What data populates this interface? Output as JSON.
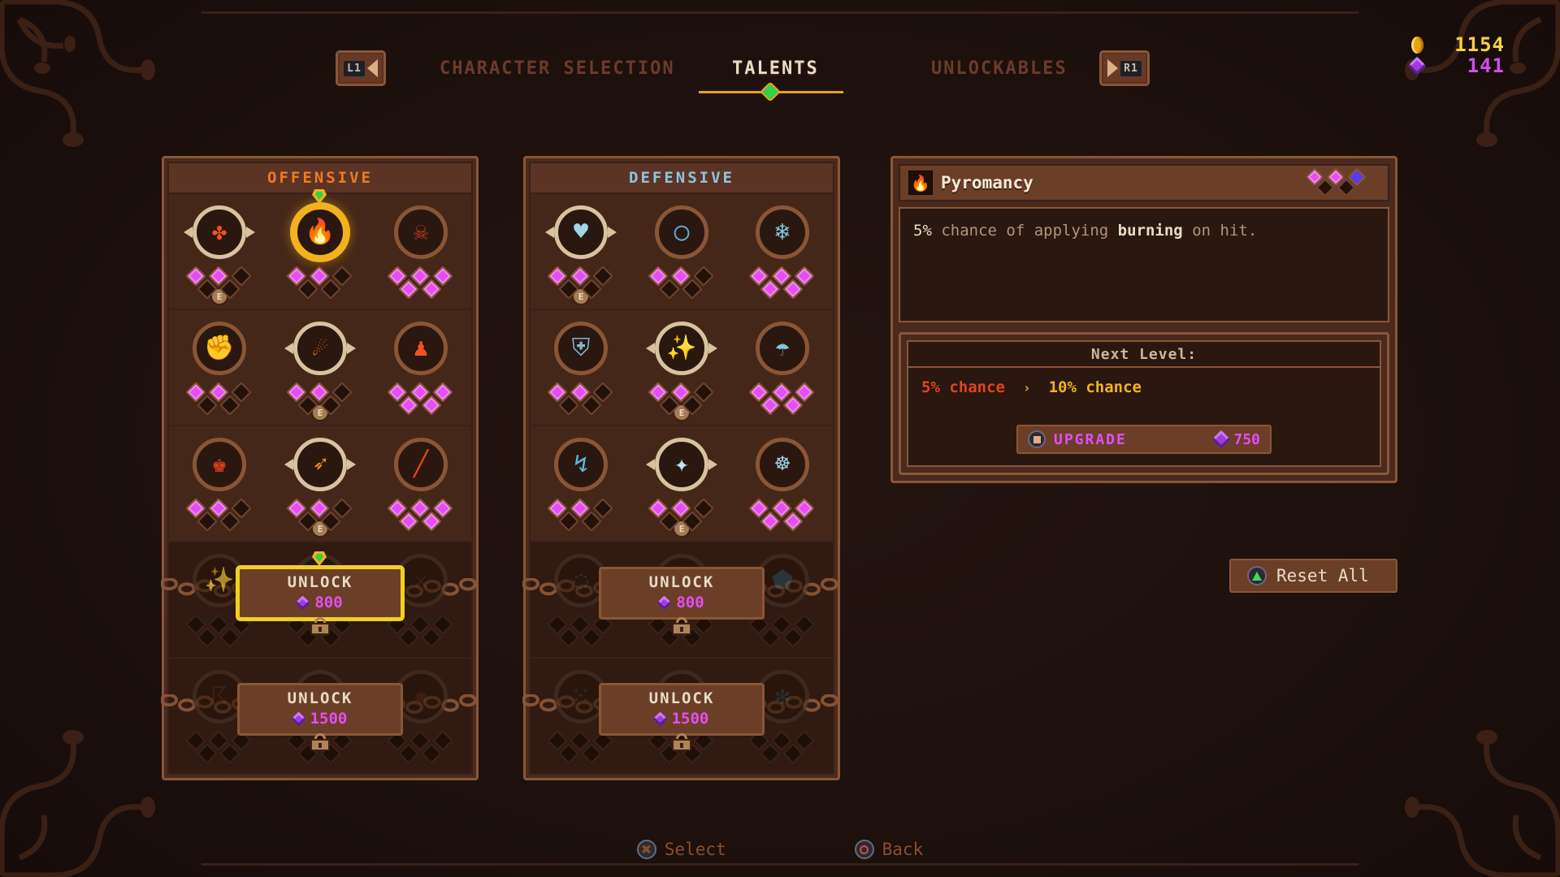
{
  "nav": {
    "left_button": {
      "key": "L1",
      "icon": "chevron-left-icon"
    },
    "right_button": {
      "key": "R1",
      "icon": "chevron-right-icon"
    },
    "tabs": [
      {
        "label": "CHARACTER SELECTION",
        "active": false
      },
      {
        "label": "TALENTS",
        "active": true
      },
      {
        "label": "UNLOCKABLES",
        "active": false
      }
    ]
  },
  "currency": {
    "gold": {
      "icon": "gold-coin-icon",
      "value": "1154"
    },
    "gem": {
      "icon": "purple-gem-icon",
      "value": "141"
    }
  },
  "columns": [
    {
      "id": "offensive",
      "title": "OFFENSIVE",
      "accent": "#f07a1f",
      "rows": [
        {
          "locked": false,
          "slots": [
            {
              "icon": "✤",
              "icon_name": "crossed-blades-icon",
              "color": "#f0531f",
              "equipped": true,
              "selected": false,
              "pips": [
                1,
                1,
                0,
                0,
                0
              ]
            },
            {
              "icon": "🔥",
              "icon_name": "flame-icon",
              "color": "#f2711c",
              "equipped": false,
              "selected": true,
              "pips": [
                1,
                1,
                0,
                0,
                0
              ]
            },
            {
              "icon": "☠",
              "icon_name": "skull-icon",
              "color": "#c43a22",
              "equipped": false,
              "selected": false,
              "pips": [
                1,
                1,
                1,
                1,
                1
              ]
            }
          ]
        },
        {
          "locked": false,
          "slots": [
            {
              "icon": "✊",
              "icon_name": "fist-icon",
              "color": "#f28c1c",
              "equipped": false,
              "selected": false,
              "pips": [
                1,
                1,
                0,
                0,
                0
              ]
            },
            {
              "icon": "☄",
              "icon_name": "comet-icon",
              "color": "#f2711c",
              "equipped": true,
              "selected": false,
              "pips": [
                1,
                1,
                0,
                0,
                0
              ]
            },
            {
              "icon": "♟",
              "icon_name": "minion-icon",
              "color": "#f0531f",
              "equipped": false,
              "selected": false,
              "pips": [
                1,
                1,
                1,
                1,
                1
              ]
            }
          ]
        },
        {
          "locked": false,
          "slots": [
            {
              "icon": "♚",
              "icon_name": "gas-mask-icon",
              "color": "#e8431c",
              "equipped": false,
              "selected": false,
              "pips": [
                1,
                1,
                0,
                0,
                0
              ]
            },
            {
              "icon": "➶",
              "icon_name": "arrow-strike-icon",
              "color": "#f28c1c",
              "equipped": true,
              "selected": false,
              "pips": [
                1,
                1,
                0,
                0,
                0
              ]
            },
            {
              "icon": "╱",
              "icon_name": "bleeding-blade-icon",
              "color": "#e8431c",
              "equipped": false,
              "selected": false,
              "pips": [
                1,
                1,
                1,
                1,
                1
              ]
            }
          ]
        },
        {
          "locked": true,
          "unlock": {
            "label": "UNLOCK",
            "cost": "800",
            "selected": true
          },
          "slots": [
            {
              "icon": "✨",
              "icon_name": "locked-talent-icon",
              "color": "#5b2a14",
              "pips": [
                0,
                0,
                0,
                0,
                0
              ]
            },
            {
              "icon": "⁂",
              "icon_name": "locked-talent-icon",
              "color": "#5b2a14",
              "pips": [
                0,
                0,
                0,
                0,
                0
              ]
            },
            {
              "icon": "⚔",
              "icon_name": "locked-talent-icon",
              "color": "#5b2a14",
              "pips": [
                0,
                0,
                0,
                0,
                0
              ]
            }
          ]
        },
        {
          "locked": true,
          "unlock": {
            "label": "UNLOCK",
            "cost": "1500",
            "selected": false
          },
          "slots": [
            {
              "icon": "☈",
              "icon_name": "locked-talent-icon",
              "color": "#4a2211",
              "pips": [
                0,
                0,
                0,
                0,
                0
              ]
            },
            {
              "icon": "❇",
              "icon_name": "locked-talent-icon",
              "color": "#4a2211",
              "pips": [
                0,
                0,
                0,
                0,
                0
              ]
            },
            {
              "icon": "✹",
              "icon_name": "locked-talent-icon",
              "color": "#4a2211",
              "pips": [
                0,
                0,
                0,
                0,
                0
              ]
            }
          ]
        }
      ]
    },
    {
      "id": "defensive",
      "title": "DEFENSIVE",
      "accent": "#8fc4da",
      "rows": [
        {
          "locked": false,
          "slots": [
            {
              "icon": "♥",
              "icon_name": "heart-icon",
              "color": "#9fd6e8",
              "equipped": true,
              "selected": false,
              "pips": [
                1,
                1,
                0,
                0,
                0
              ]
            },
            {
              "icon": "◯",
              "icon_name": "shield-ring-icon",
              "color": "#5fb6d6",
              "equipped": false,
              "selected": false,
              "pips": [
                1,
                1,
                0,
                0,
                0
              ]
            },
            {
              "icon": "❄",
              "icon_name": "frost-dash-icon",
              "color": "#7fc8e0",
              "equipped": false,
              "selected": false,
              "pips": [
                1,
                1,
                1,
                1,
                1
              ]
            }
          ]
        },
        {
          "locked": false,
          "slots": [
            {
              "icon": "⛨",
              "icon_name": "shield-icon",
              "color": "#7fb8d0",
              "equipped": false,
              "selected": false,
              "pips": [
                1,
                1,
                0,
                0,
                0
              ]
            },
            {
              "icon": "✨",
              "icon_name": "sparkle-potion-icon",
              "color": "#9fd6e8",
              "equipped": true,
              "selected": false,
              "pips": [
                1,
                1,
                0,
                0,
                0
              ]
            },
            {
              "icon": "☂",
              "icon_name": "deflect-icon",
              "color": "#7fc8e0",
              "equipped": false,
              "selected": false,
              "pips": [
                1,
                1,
                1,
                1,
                1
              ]
            }
          ]
        },
        {
          "locked": false,
          "slots": [
            {
              "icon": "↯",
              "icon_name": "dash-icon",
              "color": "#5fb6d6",
              "equipped": false,
              "selected": false,
              "pips": [
                1,
                1,
                0,
                0,
                0
              ]
            },
            {
              "icon": "✦",
              "icon_name": "star-burst-icon",
              "color": "#bfe4f2",
              "equipped": true,
              "selected": false,
              "pips": [
                1,
                1,
                0,
                0,
                0
              ]
            },
            {
              "icon": "☸",
              "icon_name": "aura-icon",
              "color": "#9fd6e8",
              "equipped": false,
              "selected": false,
              "pips": [
                1,
                1,
                1,
                1,
                1
              ]
            }
          ]
        },
        {
          "locked": true,
          "unlock": {
            "label": "UNLOCK",
            "cost": "800",
            "selected": false
          },
          "slots": [
            {
              "icon": "◌",
              "icon_name": "locked-talent-icon",
              "color": "#2d4450",
              "pips": [
                0,
                0,
                0,
                0,
                0
              ]
            },
            {
              "icon": "⁂",
              "icon_name": "locked-talent-icon",
              "color": "#2d4450",
              "pips": [
                0,
                0,
                0,
                0,
                0
              ]
            },
            {
              "icon": "⬟",
              "icon_name": "locked-talent-icon",
              "color": "#2d4450",
              "pips": [
                0,
                0,
                0,
                0,
                0
              ]
            }
          ]
        },
        {
          "locked": true,
          "unlock": {
            "label": "UNLOCK",
            "cost": "1500",
            "selected": false
          },
          "slots": [
            {
              "icon": "⁙",
              "icon_name": "locked-talent-icon",
              "color": "#253a45",
              "pips": [
                0,
                0,
                0,
                0,
                0
              ]
            },
            {
              "icon": "⚔",
              "icon_name": "locked-talent-icon",
              "color": "#253a45",
              "pips": [
                0,
                0,
                0,
                0,
                0
              ]
            },
            {
              "icon": "✻",
              "icon_name": "locked-talent-icon",
              "color": "#253a45",
              "pips": [
                0,
                0,
                0,
                0,
                0
              ]
            }
          ]
        }
      ]
    }
  ],
  "detail": {
    "icon": "🔥",
    "icon_name": "flame-icon",
    "name": "Pyromancy",
    "pips": [
      1,
      1,
      2,
      0,
      0
    ],
    "description_pre": "5%",
    "description_mid": " chance of applying ",
    "description_bold": "burning",
    "description_post": " on hit.",
    "next_level": {
      "title": "Next Level:",
      "from": "5% chance",
      "arrow": "›",
      "to": "10% chance"
    },
    "upgrade": {
      "button_icon": "square-button-icon",
      "label": "UPGRADE",
      "cost": "750",
      "cost_icon": "purple-gem-icon"
    }
  },
  "reset": {
    "button_icon": "triangle-button-icon",
    "label": "Reset All"
  },
  "footer": [
    {
      "icon": "cross-button-icon",
      "glyph": "✖",
      "label": "Select"
    },
    {
      "icon": "circle-button-icon",
      "glyph": "",
      "label": "Back"
    }
  ]
}
